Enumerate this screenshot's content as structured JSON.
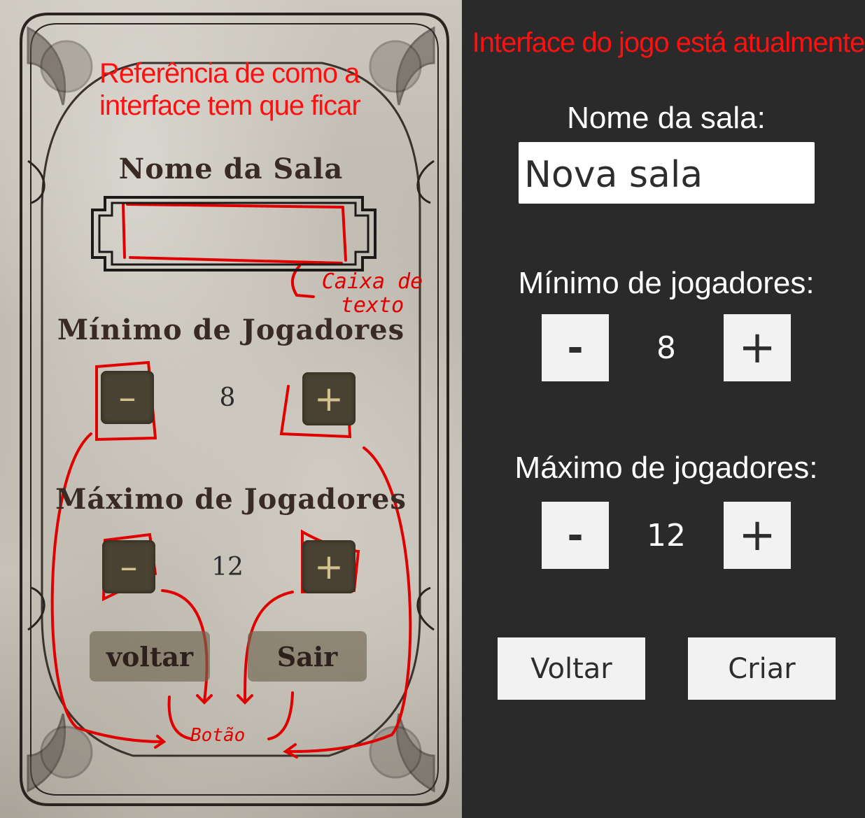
{
  "reference": {
    "note": "Referência de como a interface tem que ficar",
    "room_name_title": "Nome da Sala",
    "textbox_annotation": "Caixa de texto",
    "min_title": "Mínimo de Jogadores",
    "min_minus": "–",
    "min_value": "8",
    "min_plus": "+",
    "max_title": "Máximo de Jogadores",
    "max_minus": "–",
    "max_value": "12",
    "max_plus": "+",
    "back_label": "voltar",
    "exit_label": "Sair",
    "button_annotation": "Botão",
    "colors": {
      "annotation": "#e00000",
      "button_fill": "#4a4232",
      "title_text": "#3a2a26"
    }
  },
  "current": {
    "note": "Interface do jogo está atualmente",
    "room_name_label": "Nome da sala:",
    "room_name_value": "Nova sala",
    "min_label": "Mínimo de jogadores:",
    "min_minus": "-",
    "min_value": "8",
    "min_plus": "+",
    "max_label": "Máximo de jogadores:",
    "max_minus": "-",
    "max_value": "12",
    "max_plus": "+",
    "back_button": "Voltar",
    "create_button": "Criar",
    "colors": {
      "background": "#2a2a2a",
      "button": "#f2f2f2",
      "note": "#ff1010"
    }
  }
}
